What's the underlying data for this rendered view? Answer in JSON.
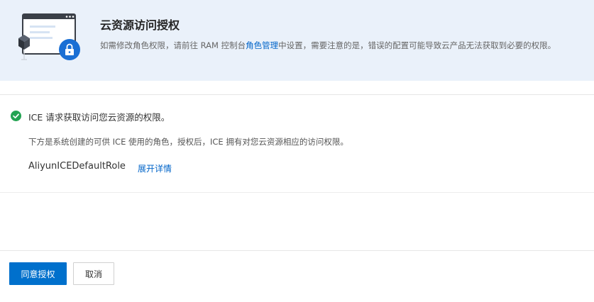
{
  "header": {
    "title": "云资源访问授权",
    "desc_before": "如需修改角色权限，请前往 RAM 控制台",
    "desc_link": "角色管理",
    "desc_after": "中设置，需要注意的是，错误的配置可能导致云产品无法获取到必要的权限。",
    "illustration_icon": "lock-shield-illustration"
  },
  "status": {
    "icon": "check-circle-icon",
    "color": "#23a352",
    "text": "ICE 请求获取访问您云资源的权限。"
  },
  "role": {
    "description": "下方是系统创建的可供 ICE 使用的角色，授权后，ICE 拥有对您云资源相应的访问权限。",
    "name": "AliyunICEDefaultRole",
    "expand_label": "展开详情"
  },
  "footer": {
    "confirm_label": "同意授权",
    "cancel_label": "取消"
  },
  "colors": {
    "accent": "#0070cc",
    "header_bg": "#eaf1fa",
    "link": "#0064c8"
  }
}
